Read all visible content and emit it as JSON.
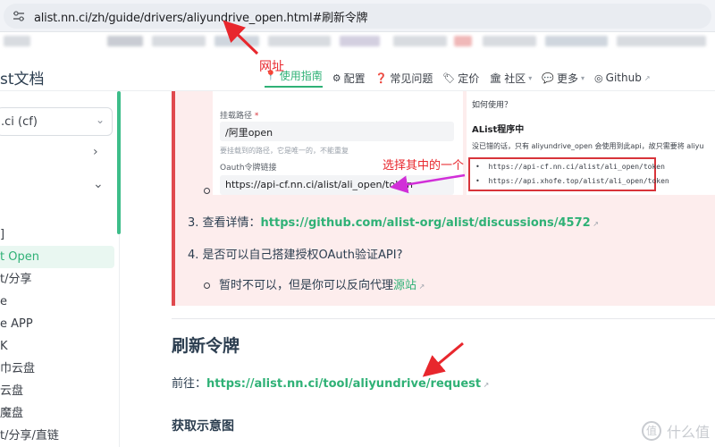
{
  "browser": {
    "url": "alist.nn.ci/zh/guide/drivers/aliyundrive_open.html#刷新令牌"
  },
  "header": {
    "title": "st文档",
    "nav": [
      {
        "icon": "📍",
        "label": "使用指南",
        "active": true,
        "ext": false
      },
      {
        "icon": "⚙",
        "label": "配置",
        "active": false,
        "ext": false
      },
      {
        "icon": "❓",
        "label": "常见问题",
        "active": false,
        "ext": false
      },
      {
        "icon": "🏷",
        "label": "定价",
        "active": false,
        "ext": false
      },
      {
        "icon": "🏛",
        "label": "社区",
        "active": false,
        "ext": false,
        "dropdown": true
      },
      {
        "icon": "💬",
        "label": "更多",
        "active": false,
        "ext": false,
        "dropdown": true
      },
      {
        "icon": "◎",
        "label": "Github",
        "active": false,
        "ext": true
      }
    ]
  },
  "sidebar": {
    "select_value": ".ci (cf)",
    "items": [
      {
        "label": "]",
        "active": false
      },
      {
        "label": "t Open",
        "active": true
      },
      {
        "label": "t/分享",
        "active": false
      },
      {
        "label": "e",
        "active": false
      },
      {
        "label": "e APP",
        "active": false
      },
      {
        "label": "K",
        "active": false
      },
      {
        "label": "巾云盘",
        "active": false
      },
      {
        "label": "云盘",
        "active": false
      },
      {
        "label": "魔盘",
        "active": false
      },
      {
        "label": "t/分享/直链",
        "active": false
      }
    ]
  },
  "embed_left": {
    "mount_label": "挂载路径",
    "required_mark": "*",
    "mount_value": "/阿里open",
    "mount_hint": "要挂载到的路径，它是唯一的，不能重复",
    "oauth_label": "Oauth令牌链接",
    "oauth_value": "https://api-cf.nn.ci/alist/ali_open/token"
  },
  "embed_right": {
    "question": "如何使用？",
    "heading": "AList程序中",
    "desc": "没已错的话，只有 aliyundrive_open 会使用到此api，故只需要将 aliyu",
    "items": [
      "https://api-cf.nn.ci/alist/ali_open/token",
      "https://api.xhofe.top/alist/ali_open/token"
    ]
  },
  "content": {
    "item3_prefix": "3. 查看详情：",
    "item3_link": "https://github.com/alist-org/alist/discussions/4572",
    "item4": "4. 是否可以自己搭建授权OAuth验证API?",
    "sub_text": "暂时不可以，但是你可以反向代理",
    "sub_link": "源站",
    "section_title": "刷新令牌",
    "goto_prefix": "前往：",
    "goto_link": "https://alist.nn.ci/tool/aliyundrive/request",
    "subsection_title": "获取示意图"
  },
  "annotations": {
    "url_label": "网址",
    "choose_label": "选择其中的一个"
  },
  "watermark": {
    "icon": "值",
    "text": "什么值"
  },
  "colors": {
    "accent": "#2fb176",
    "danger_bg": "#fdeded",
    "danger_border": "#e0494e",
    "annotation_red": "#e8272d",
    "annotation_magenta": "#d12fd8"
  }
}
